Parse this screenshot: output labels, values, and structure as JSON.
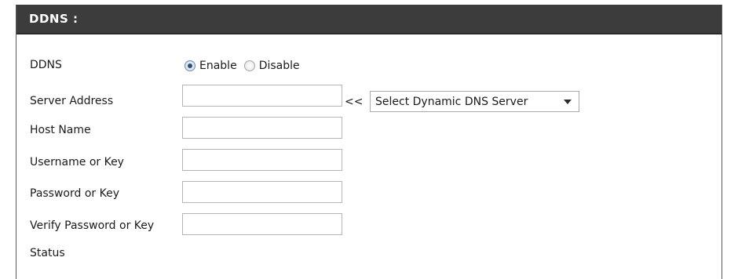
{
  "section": {
    "title": "DDNS :"
  },
  "ddns": {
    "label": "DDNS",
    "enable_label": "Enable",
    "disable_label": "Disable",
    "selected": "Enable"
  },
  "server_address": {
    "label": "Server Address",
    "value": "",
    "arrows": "<<",
    "select_value": "Select Dynamic DNS Server"
  },
  "host_name": {
    "label": "Host Name",
    "value": ""
  },
  "username": {
    "label": "Username or Key",
    "value": ""
  },
  "password": {
    "label": "Password or Key",
    "value": ""
  },
  "verify_password": {
    "label": "Verify Password or Key",
    "value": ""
  },
  "status": {
    "label": "Status",
    "value": ""
  },
  "colors": {
    "header_bg": "#3c3c3c",
    "header_text": "#ffffff",
    "input_border": "#b5b5b5"
  }
}
